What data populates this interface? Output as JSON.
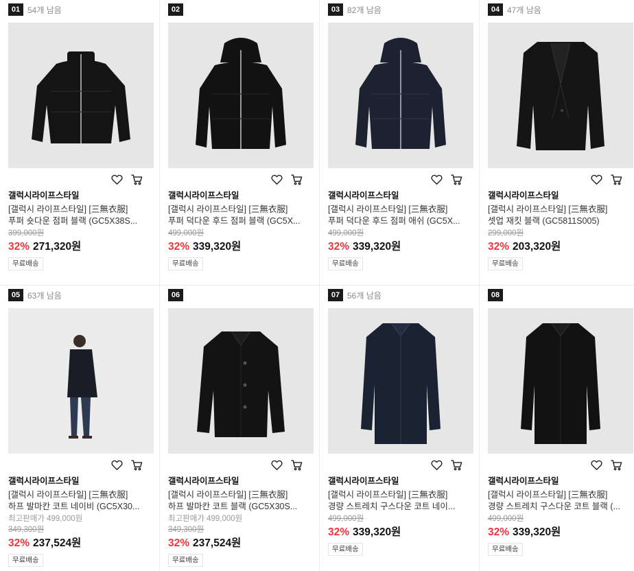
{
  "products": [
    {
      "rank": "01",
      "remaining": "54개 남음",
      "brand": "갤럭시라이프스타일",
      "name_line1": "[갤럭시 라이프스타일] [三無衣服]",
      "name_line2": "푸퍼 숏다운 점퍼 블랙 (GC5X38S...",
      "note": "",
      "original_price": "399,000원",
      "discount": "32%",
      "price": "271,320원",
      "shipping": "무료배송",
      "image": "puffer-jacket-black-short",
      "garment_color": "#141414"
    },
    {
      "rank": "02",
      "remaining": "",
      "brand": "갤럭시라이프스타일",
      "name_line1": "[갤럭시 라이프스타일] [三無衣服]",
      "name_line2": "푸퍼 덕다운 후드 점퍼 블랙 (GC5X...",
      "note": "",
      "original_price": "499,000원",
      "discount": "32%",
      "price": "339,320원",
      "shipping": "무료배송",
      "image": "hooded-puffer-black",
      "garment_color": "#121212"
    },
    {
      "rank": "03",
      "remaining": "82개 남음",
      "brand": "갤럭시라이프스타일",
      "name_line1": "[갤럭시 라이프스타일] [三無衣服]",
      "name_line2": "푸퍼 덕다운 후드 점퍼 애쉬 (GC5X...",
      "note": "",
      "original_price": "499,000원",
      "discount": "32%",
      "price": "339,320원",
      "shipping": "무료배송",
      "image": "hooded-puffer-navy",
      "garment_color": "#1c2230"
    },
    {
      "rank": "04",
      "remaining": "47개 남음",
      "brand": "갤럭시라이프스타일",
      "name_line1": "[갤럭시 라이프스타일] [三無衣服]",
      "name_line2": "셋업 재킷 블랙 (GC5811S005)",
      "note": "",
      "original_price": "299,000원",
      "discount": "32%",
      "price": "203,320원",
      "shipping": "무료배송",
      "image": "blazer-black",
      "garment_color": "#151515"
    },
    {
      "rank": "05",
      "remaining": "63개 남음",
      "brand": "갤럭시라이프스타일",
      "name_line1": "[갤럭시 라이프스타일] [三無衣服]",
      "name_line2": "하프 발마칸 코트 네이비 (GC5X30...",
      "note": "최고판매가 499,000원",
      "original_price": "349,300원",
      "discount": "32%",
      "price": "237,524원",
      "shipping": "무료배송",
      "image": "model-wearing-coat",
      "garment_color": "#1a1d26"
    },
    {
      "rank": "06",
      "remaining": "",
      "brand": "갤럭시라이프스타일",
      "name_line1": "[갤럭시 라이프스타일] [三無衣服]",
      "name_line2": "하프 발마칸 코트 블랙 (GC5X30S...",
      "note": "최고판매가 499,000원",
      "original_price": "349,300원",
      "discount": "32%",
      "price": "237,524원",
      "shipping": "무료배송",
      "image": "half-balmacaan-coat-black",
      "garment_color": "#131313"
    },
    {
      "rank": "07",
      "remaining": "56개 남음",
      "brand": "갤럭시라이프스타일",
      "name_line1": "[갤럭시 라이프스타일] [三無衣服]",
      "name_line2": "경량 스트레치 구스다운 코트 네이...",
      "note": "",
      "original_price": "499,000원",
      "discount": "32%",
      "price": "339,320원",
      "shipping": "무료배송",
      "image": "long-down-coat-navy",
      "garment_color": "#1b2232"
    },
    {
      "rank": "08",
      "remaining": "",
      "brand": "갤럭시라이프스타일",
      "name_line1": "[갤럭시 라이프스타일] [三無衣服]",
      "name_line2": "경량 스트레치 구스다운 코트 블랙 (...",
      "note": "",
      "original_price": "499,000원",
      "discount": "32%",
      "price": "339,320원",
      "shipping": "무료배송",
      "image": "long-down-coat-black",
      "garment_color": "#121212"
    }
  ],
  "icons": {
    "wishlist": "heart-icon",
    "cart": "cart-icon"
  },
  "colors": {
    "discount": "#f0343c",
    "rank_badge": "#1b1b1b",
    "thumbnail_bg": "#e6e6e6"
  }
}
